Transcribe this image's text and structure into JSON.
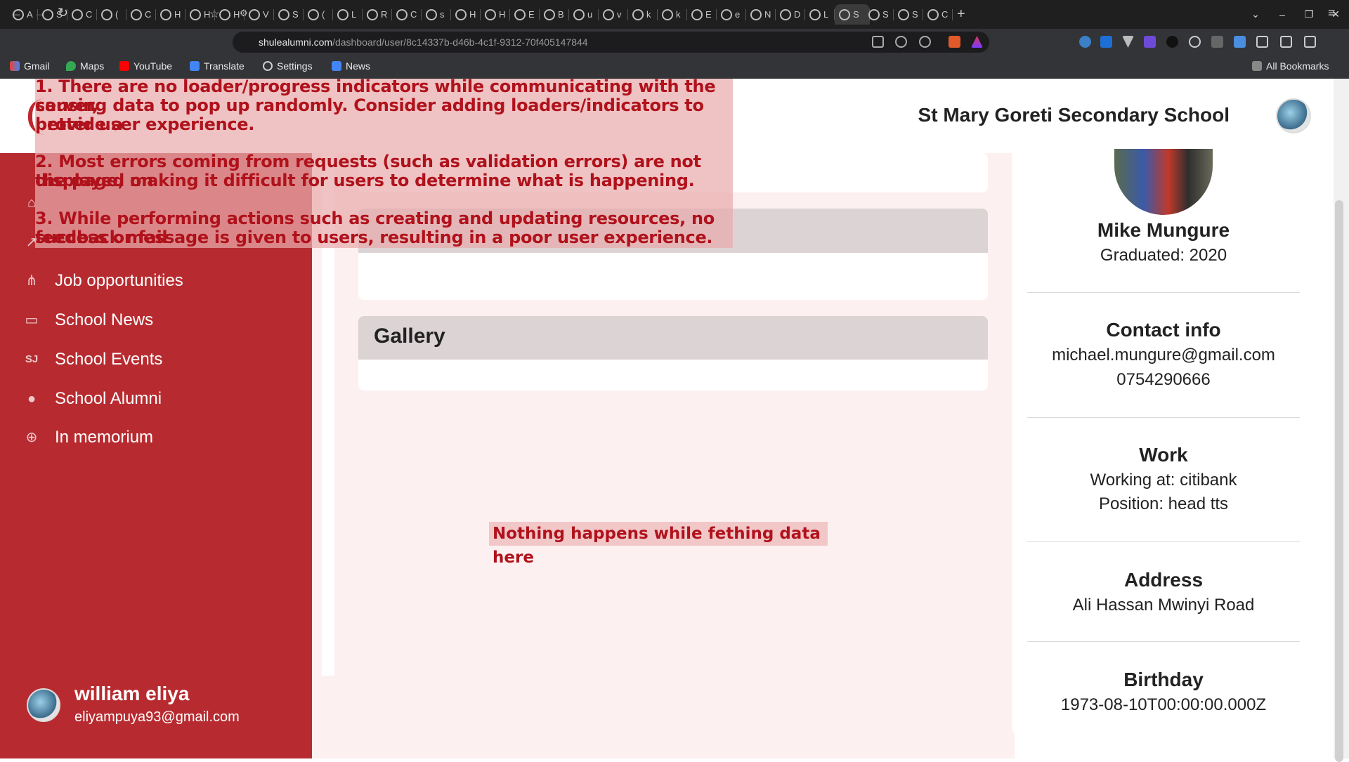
{
  "browser": {
    "tabs": [
      "A",
      "S",
      "C",
      "(",
      "C",
      "H",
      "H",
      "H",
      "V",
      "S",
      "(",
      "L",
      "R",
      "C",
      "s",
      "H",
      "H",
      "E",
      "B",
      "u",
      "v",
      "k",
      "k",
      "E",
      "e",
      "N",
      "D",
      "L",
      "S",
      "S",
      "S",
      "C"
    ],
    "active_tab": "S",
    "url_host": "shulealumni.com",
    "url_path": "/dashboard/user/8c14337b-d46b-4c1f-9312-70f405147844",
    "bookmarks": [
      "Gmail",
      "Maps",
      "YouTube",
      "Translate",
      "Settings",
      "News"
    ],
    "all_bookmarks": "All Bookmarks"
  },
  "header": {
    "school_name": "St Mary Goreti Secondary School"
  },
  "sidebar": {
    "items": [
      {
        "label": "Job opportunities",
        "icon": "sitemap-icon"
      },
      {
        "label": "School News",
        "icon": "monitor-icon"
      },
      {
        "label": "School Events",
        "icon": "sj-icon"
      },
      {
        "label": "School Alumni",
        "icon": "users-icon"
      },
      {
        "label": "In memorium",
        "icon": "plus-circle-icon"
      }
    ],
    "user": {
      "name": "william eliya",
      "email": "eliyampuya93@gmail.com"
    }
  },
  "main": {
    "gallery_title": "Gallery"
  },
  "profile": {
    "name": "Mike Mungure",
    "graduated": "Graduated: 2020",
    "contact_title": "Contact info",
    "email": "michael.mungure@gmail.com",
    "phone": "0754290666",
    "work_title": "Work",
    "working_at": "Working at: citibank",
    "position": "Position: head tts",
    "address_title": "Address",
    "address": "Ali Hassan Mwinyi Road",
    "birthday_title": "Birthday",
    "birthday": "1973-08-10T00:00:00.000Z"
  },
  "annotations": {
    "p1_l1": "1. There are no loader/progress indicators while communicating with the server,",
    "p1_l2": "causing data to pop up randomly. Consider adding loaders/indicators to provide a",
    "p1_l3": "better user experience.",
    "p2_l1": "2. Most errors coming from requests (such as validation errors) are not displayed on",
    "p2_l2": "the page, making it difficult for users to determine what is happening.",
    "p3_l1": "3. While performing actions such as creating and updating resources, no success or fail",
    "p3_l2": "feedback message is given to users, resulting in a poor user experience.",
    "fetch_note": "Nothing happens while fething data here"
  },
  "colors": {
    "sidebar": "#b72b30",
    "annotation_text": "#b0121c",
    "content_bg": "#fdf0f0"
  }
}
